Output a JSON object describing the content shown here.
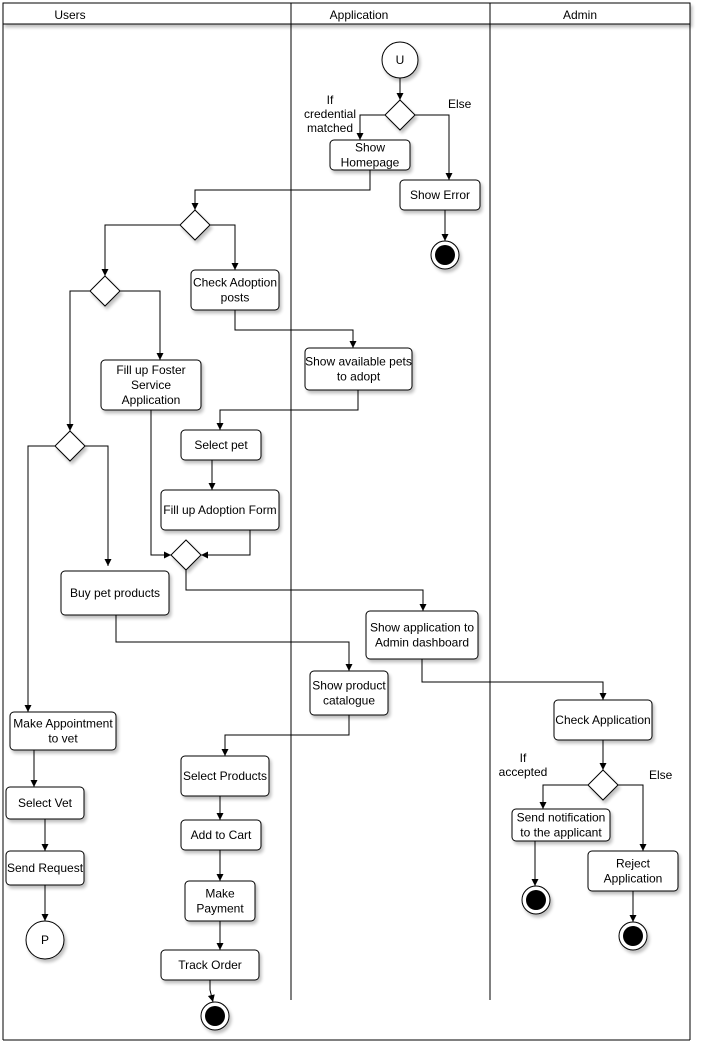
{
  "lanes": [
    {
      "id": "users",
      "title": "Users"
    },
    {
      "id": "application",
      "title": "Application"
    },
    {
      "id": "admin",
      "title": "Admin"
    }
  ],
  "nodes": [
    {
      "id": "start",
      "type": "initial",
      "label": "U"
    },
    {
      "id": "d_login",
      "type": "decision"
    },
    {
      "id": "show_homepage",
      "type": "action",
      "lines": [
        "Show",
        "Homepage"
      ]
    },
    {
      "id": "show_error",
      "type": "action",
      "lines": [
        "Show Error"
      ]
    },
    {
      "id": "end_error",
      "type": "final"
    },
    {
      "id": "d_main",
      "type": "decision"
    },
    {
      "id": "check_posts",
      "type": "action",
      "lines": [
        "Check Adoption",
        "posts"
      ]
    },
    {
      "id": "d_service",
      "type": "decision"
    },
    {
      "id": "fill_foster",
      "type": "action",
      "lines": [
        "Fill up Foster",
        "Service",
        "Application"
      ]
    },
    {
      "id": "show_pets",
      "type": "action",
      "lines": [
        "Show available pets",
        "to adopt"
      ]
    },
    {
      "id": "select_pet",
      "type": "action",
      "lines": [
        "Select pet"
      ]
    },
    {
      "id": "fill_adoption",
      "type": "action",
      "lines": [
        "Fill up Adoption Form"
      ]
    },
    {
      "id": "d_other",
      "type": "decision"
    },
    {
      "id": "d_merge",
      "type": "decision"
    },
    {
      "id": "buy_products",
      "type": "action",
      "lines": [
        "Buy pet products"
      ]
    },
    {
      "id": "show_to_admin",
      "type": "action",
      "lines": [
        "Show application to",
        "Admin dashboard"
      ]
    },
    {
      "id": "show_catalogue",
      "type": "action",
      "lines": [
        "Show product",
        "catalogue"
      ]
    },
    {
      "id": "check_application",
      "type": "action",
      "lines": [
        "Check Application"
      ]
    },
    {
      "id": "d_accept",
      "type": "decision"
    },
    {
      "id": "send_notification",
      "type": "action",
      "lines": [
        "Send notification",
        "to the applicant"
      ]
    },
    {
      "id": "reject_application",
      "type": "action",
      "lines": [
        "Reject",
        "Application"
      ]
    },
    {
      "id": "end_accept",
      "type": "final"
    },
    {
      "id": "end_reject",
      "type": "final"
    },
    {
      "id": "make_appointment",
      "type": "action",
      "lines": [
        "Make Appointment",
        "to vet"
      ]
    },
    {
      "id": "select_vet",
      "type": "action",
      "lines": [
        "Select Vet"
      ]
    },
    {
      "id": "send_request",
      "type": "action",
      "lines": [
        "Send Request"
      ]
    },
    {
      "id": "connector_p",
      "type": "connector",
      "label": "P"
    },
    {
      "id": "select_products",
      "type": "action",
      "lines": [
        "Select Products"
      ]
    },
    {
      "id": "add_to_cart",
      "type": "action",
      "lines": [
        "Add to Cart"
      ]
    },
    {
      "id": "make_payment",
      "type": "action",
      "lines": [
        "Make",
        "Payment"
      ]
    },
    {
      "id": "track_order",
      "type": "action",
      "lines": [
        "Track Order"
      ]
    },
    {
      "id": "end_order",
      "type": "final"
    }
  ],
  "guards": [
    {
      "id": "guard_credential",
      "lines": [
        "If",
        "credential",
        "matched"
      ]
    },
    {
      "id": "guard_else_login",
      "lines": [
        "Else"
      ]
    },
    {
      "id": "guard_accepted",
      "lines": [
        "If",
        "accepted"
      ]
    },
    {
      "id": "guard_else_admin",
      "lines": [
        "Else"
      ]
    }
  ]
}
